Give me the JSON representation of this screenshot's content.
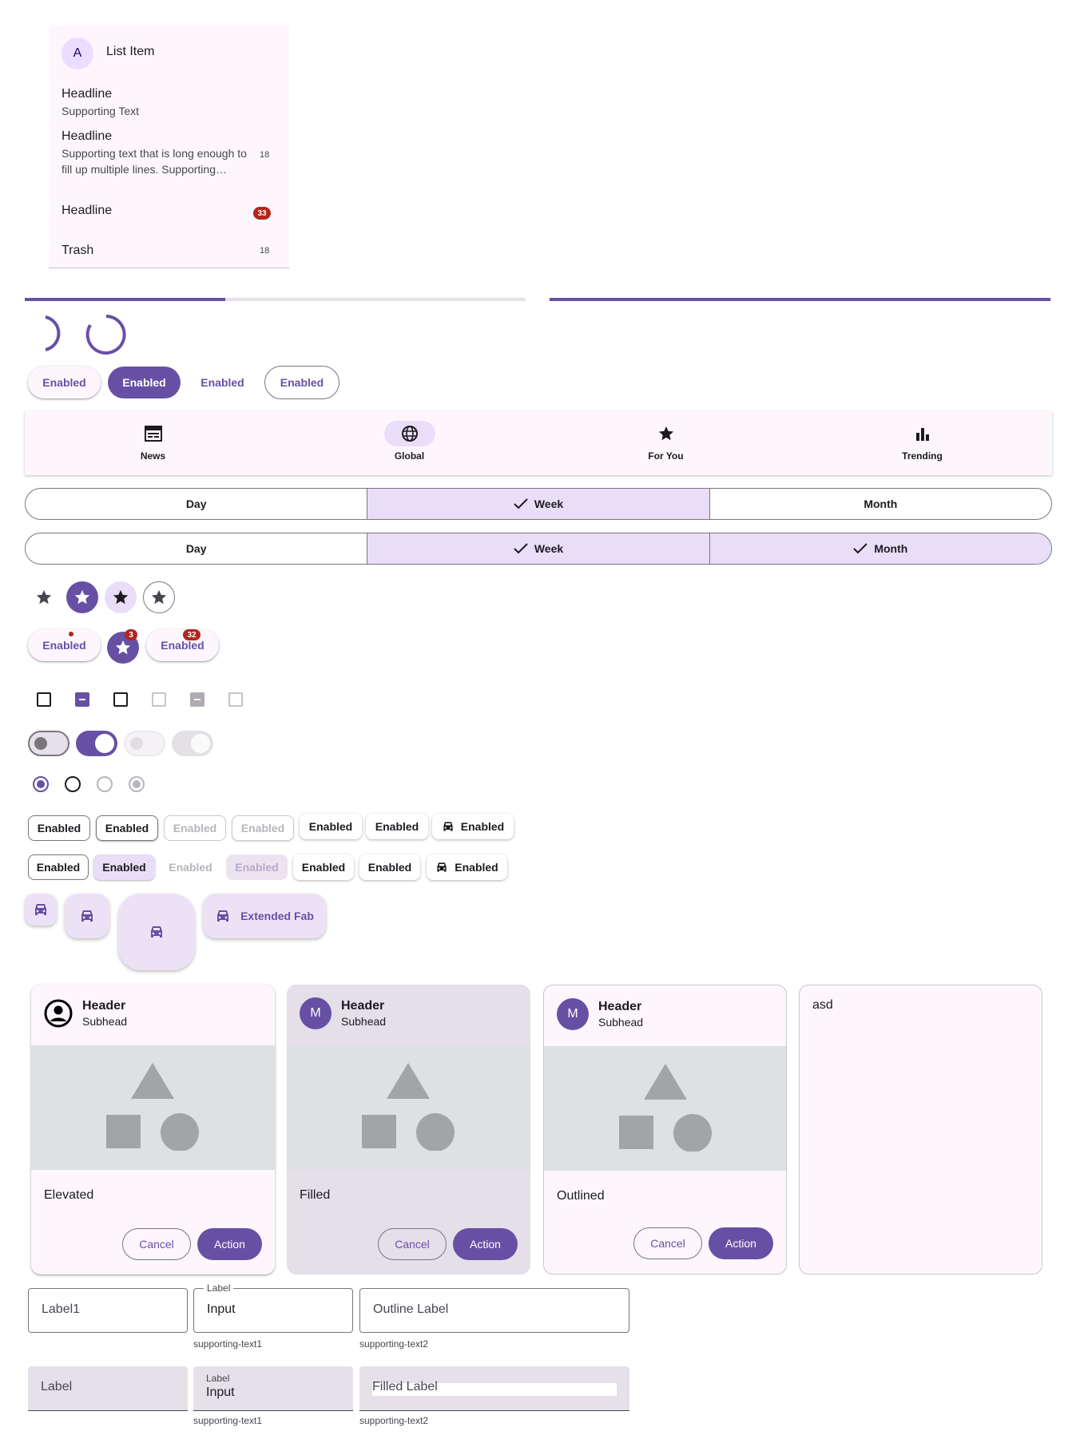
{
  "list": {
    "item1": {
      "avatar": "A",
      "label": "List Item"
    },
    "item2": {
      "headline": "Headline",
      "supporting": "Supporting Text"
    },
    "item3": {
      "headline": "Headline",
      "supporting": "Supporting text that is long enough to fill up multiple lines. Supporting…",
      "meta": "18"
    },
    "item4": {
      "headline": "Headline",
      "badge": "33"
    },
    "item5": {
      "headline": "Trash",
      "meta": "18"
    }
  },
  "progress": {
    "linear1": 0.4,
    "linear2": 1.0
  },
  "buttons": {
    "elevated": "Enabled",
    "filled": "Enabled",
    "text": "Enabled",
    "outlined": "Enabled"
  },
  "navbar": {
    "items": [
      {
        "label": "News",
        "icon": "newspaper-icon"
      },
      {
        "label": "Global",
        "icon": "globe-icon",
        "selected": true
      },
      {
        "label": "For You",
        "icon": "star-icon"
      },
      {
        "label": "Trending",
        "icon": "bar-chart-icon"
      }
    ]
  },
  "segmented1": {
    "items": [
      "Day",
      "Week",
      "Month"
    ],
    "selected": [
      "Week"
    ]
  },
  "segmented2": {
    "items": [
      "Day",
      "Week",
      "Month"
    ],
    "selected": [
      "Week",
      "Month"
    ]
  },
  "badged": {
    "button1": "Enabled",
    "badge_star": "3",
    "button2": "Enabled",
    "badge2": "32"
  },
  "chips_row1": [
    "Enabled",
    "Enabled",
    "Enabled",
    "Enabled",
    "Enabled",
    "Enabled",
    "Enabled"
  ],
  "chips_row2": [
    "Enabled",
    "Enabled",
    "Enabled",
    "Enabled",
    "Enabled",
    "Enabled",
    "Enabled"
  ],
  "fab": {
    "extended_label": "Extended Fab",
    "icon": "taxi-icon"
  },
  "cards": [
    {
      "title": "Header",
      "subhead": "Subhead",
      "body": "Elevated",
      "cancel": "Cancel",
      "action": "Action"
    },
    {
      "avatar": "M",
      "title": "Header",
      "subhead": "Subhead",
      "body": "Filled",
      "cancel": "Cancel",
      "action": "Action"
    },
    {
      "avatar": "M",
      "title": "Header",
      "subhead": "Subhead",
      "body": "Outlined",
      "cancel": "Cancel",
      "action": "Action"
    },
    {
      "body": "asd"
    }
  ],
  "textfields": {
    "out1": "Label1",
    "out2": {
      "label": "Label",
      "value": "Input",
      "support": "supporting-text1"
    },
    "out3": {
      "label": "Outline Label",
      "support": "supporting-text2"
    },
    "fill1": "Label",
    "fill2": {
      "label": "Label",
      "value": "Input",
      "support": "supporting-text1"
    },
    "fill3": {
      "label": "Filled Label",
      "support": "supporting-text2"
    }
  },
  "colors": {
    "primary": "#6750a4",
    "error": "#b3261e",
    "secondary_container": "#e8def8"
  }
}
